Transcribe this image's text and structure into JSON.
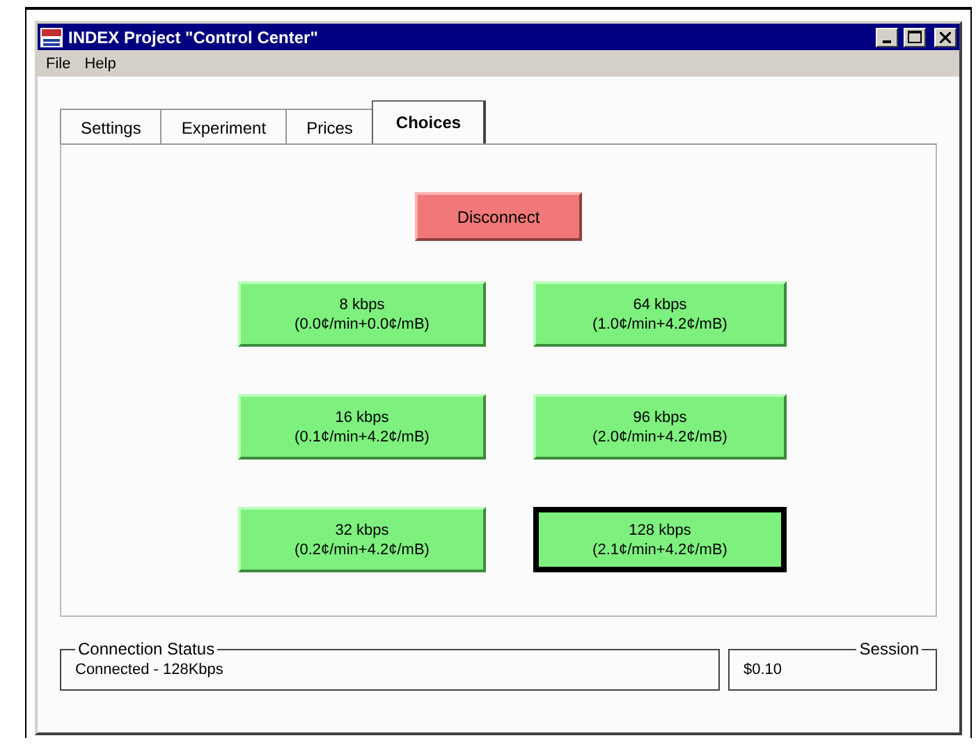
{
  "window": {
    "title": "INDEX Project \"Control Center\""
  },
  "menu": [
    "File",
    "Help"
  ],
  "tabs": [
    {
      "label": "Settings",
      "selected": false
    },
    {
      "label": "Experiment",
      "selected": false
    },
    {
      "label": "Prices",
      "selected": false
    },
    {
      "label": "Choices",
      "selected": true
    }
  ],
  "disconnect": {
    "label": "Disconnect"
  },
  "choices": [
    {
      "rate": "8 kbps",
      "price": "(0.0¢/min+0.0¢/mB)",
      "selected": false
    },
    {
      "rate": "64 kbps",
      "price": "(1.0¢/min+4.2¢/mB)",
      "selected": false
    },
    {
      "rate": "16 kbps",
      "price": "(0.1¢/min+4.2¢/mB)",
      "selected": false
    },
    {
      "rate": "96 kbps",
      "price": "(2.0¢/min+4.2¢/mB)",
      "selected": false
    },
    {
      "rate": "32 kbps",
      "price": "(0.2¢/min+4.2¢/mB)",
      "selected": false
    },
    {
      "rate": "128 kbps",
      "price": "(2.1¢/min+4.2¢/mB)",
      "selected": true
    }
  ],
  "connection_status": {
    "legend": "Connection Status",
    "value": "Connected - 128Kbps"
  },
  "session": {
    "legend": "Session",
    "value": "$0.10"
  }
}
